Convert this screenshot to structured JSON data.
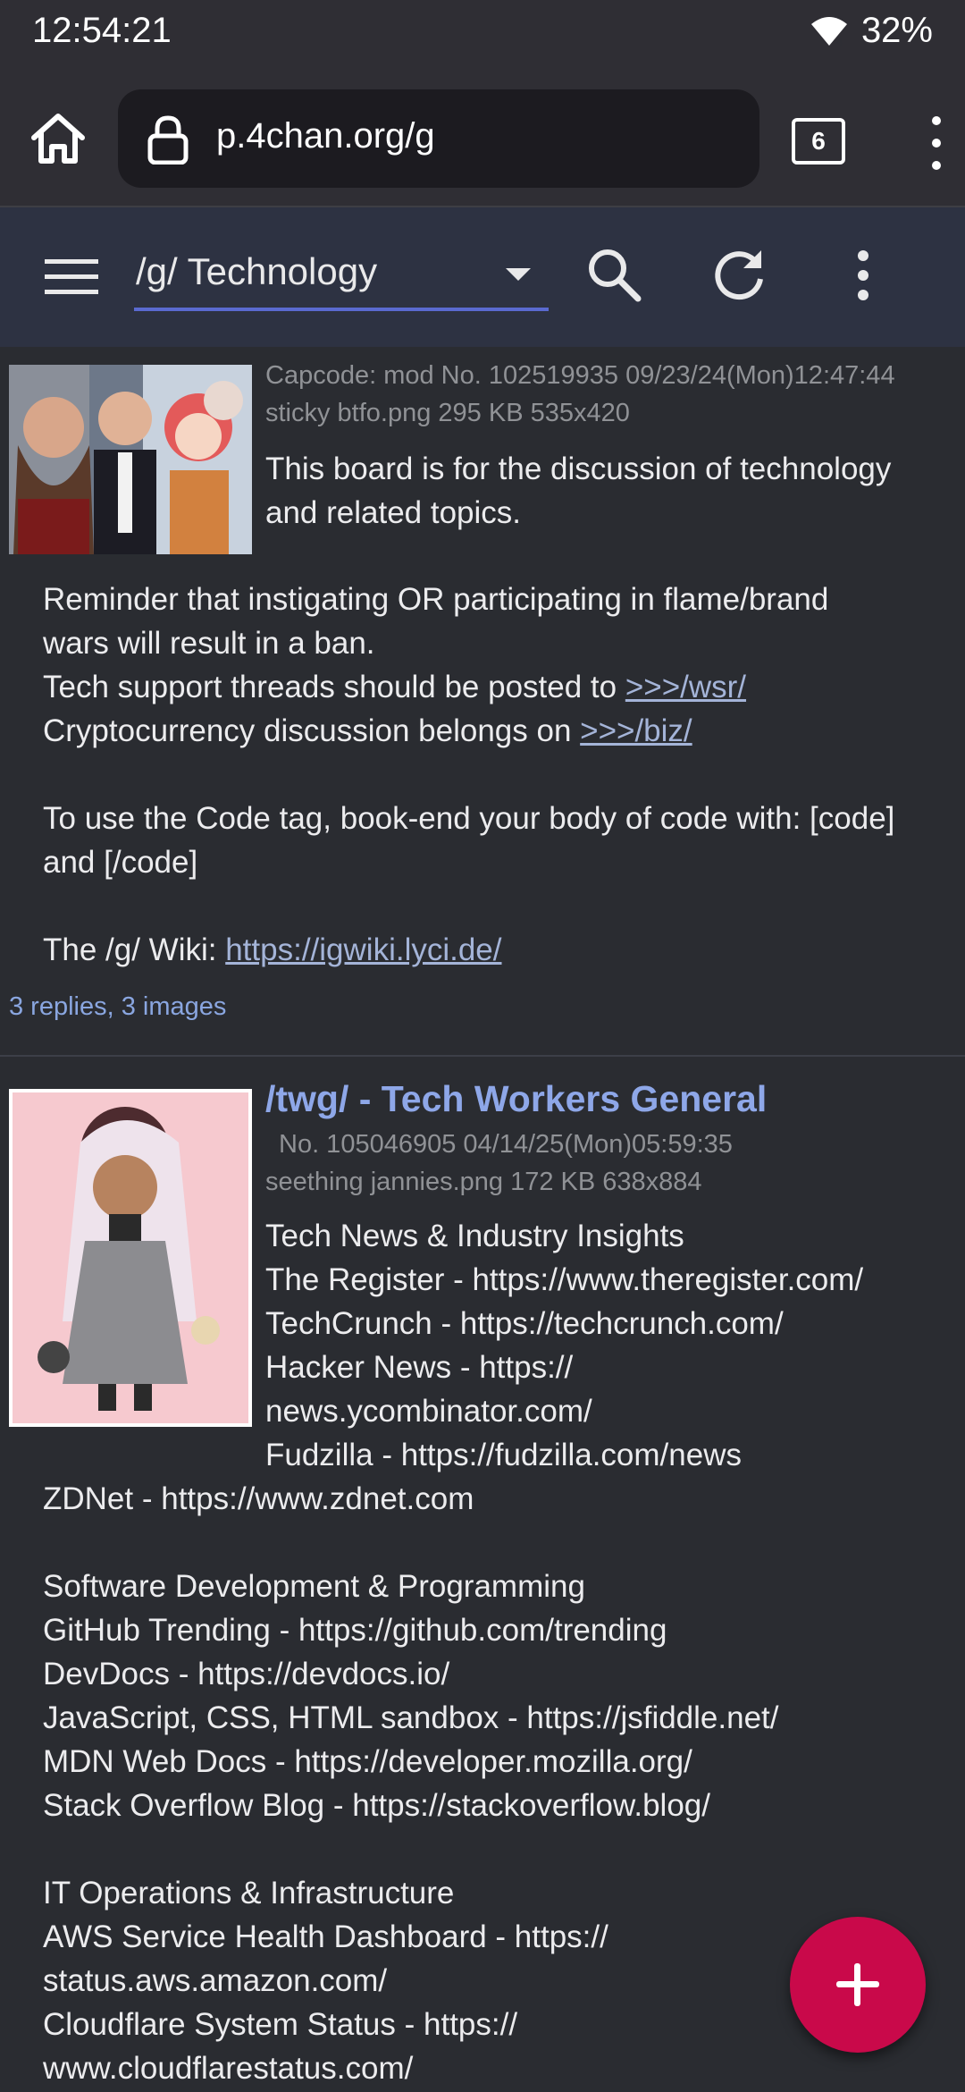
{
  "status_bar": {
    "time": "12:54:21",
    "battery": "32%"
  },
  "browser": {
    "url": "p.4chan.org/g",
    "tab_count": "6"
  },
  "toolbar": {
    "board": "/g/ Technology"
  },
  "posts": [
    {
      "meta_line1": "Capcode: mod  No. 102519935 09/23/24(Mon)12:47:44",
      "meta_line2": "sticky btfo.png 295 KB 535x420",
      "intro_1": "This board is for the discussion of technology",
      "intro_2": "and related topics.",
      "line_1": "Reminder that instigating OR participating in flame/brand",
      "line_2": "wars will result in a ban.",
      "line_3": "Tech support threads should be posted to ",
      "link_wsr": ">>>/wsr/",
      "line_4": "Cryptocurrency discussion belongs on ",
      "link_biz": ">>>/biz/",
      "line_5": "To use the Code tag, book-end your body of code with: [code]",
      "line_6": "and [/code]",
      "line_7": "The /g/ Wiki: ",
      "link_wiki": "https://igwiki.lyci.de/",
      "replies": "3 replies, 3 images"
    },
    {
      "subject": "/twg/ - Tech Workers General",
      "meta_line1": "No. 105046905 04/14/25(Mon)05:59:35",
      "meta_line2": "seething jannies.png 172 KB 638x884",
      "lines": [
        "Tech News & Industry Insights",
        "The Register - https://www.theregister.com/",
        "TechCrunch - https://techcrunch.com/",
        "Hacker News - https://",
        "news.ycombinator.com/",
        "Fudzilla - https://fudzilla.com/news"
      ],
      "lines_full": [
        "ZDNet - https://www.zdnet.com",
        "",
        "Software Development & Programming",
        "GitHub Trending - https://github.com/trending",
        "DevDocs - https://devdocs.io/",
        "JavaScript, CSS, HTML sandbox - https://jsfiddle.net/",
        "MDN Web Docs - https://developer.mozilla.org/",
        "Stack Overflow Blog - https://stackoverflow.blog/",
        "",
        "IT Operations & Infrastructure",
        "AWS Service Health Dashboard - https://",
        "status.aws.amazon.com/",
        "Cloudflare System Status - https://",
        "www.cloudflarestatus.com/"
      ]
    }
  ],
  "colors": {
    "accent": "#c9094a",
    "link": "#8aa6e0",
    "subject": "#8ea7e8",
    "toolbar": "#2d3242"
  }
}
